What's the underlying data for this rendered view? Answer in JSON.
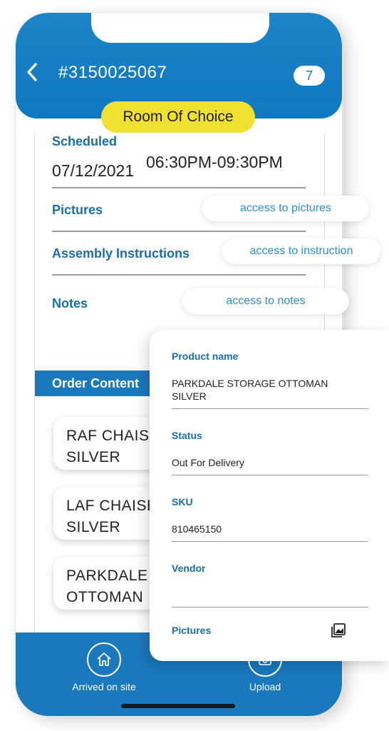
{
  "header": {
    "order_id": "#3150025067",
    "count": "7",
    "room": "Room Of Choice"
  },
  "details": {
    "scheduled_label": "Scheduled",
    "date": "07/12/2021",
    "time": "06:30PM-09:30PM",
    "pictures_label": "Pictures",
    "assembly_label": "Assembly Instructions",
    "notes_label": "Notes"
  },
  "order_contents": {
    "header": "Order Content",
    "items": [
      {
        "line1": "RAF CHAISE",
        "line2": "SILVER"
      },
      {
        "line1": "LAF CHAISE",
        "line2": "SILVER"
      },
      {
        "line1": "PARKDALE",
        "line2": "OTTOMAN"
      }
    ]
  },
  "bottom_bar": {
    "arrived_label": "Arrived on site",
    "upload_label": "Upload"
  },
  "callouts": {
    "pictures": "access to pictures",
    "instruction": "access to instruction",
    "notes": "access to notes"
  },
  "product_panel": {
    "product_name_label": "Product name",
    "product_name": "PARKDALE STORAGE OTTOMAN SILVER",
    "status_label": "Status",
    "status": "Out For Delivery",
    "sku_label": "SKU",
    "sku": "810465150",
    "vendor_label": "Vendor",
    "vendor": "",
    "pictures_label": "Pictures"
  },
  "colors": {
    "primary": "#1a78bd",
    "accent_yellow": "#f0e130",
    "label_blue": "#1a6fa8"
  }
}
